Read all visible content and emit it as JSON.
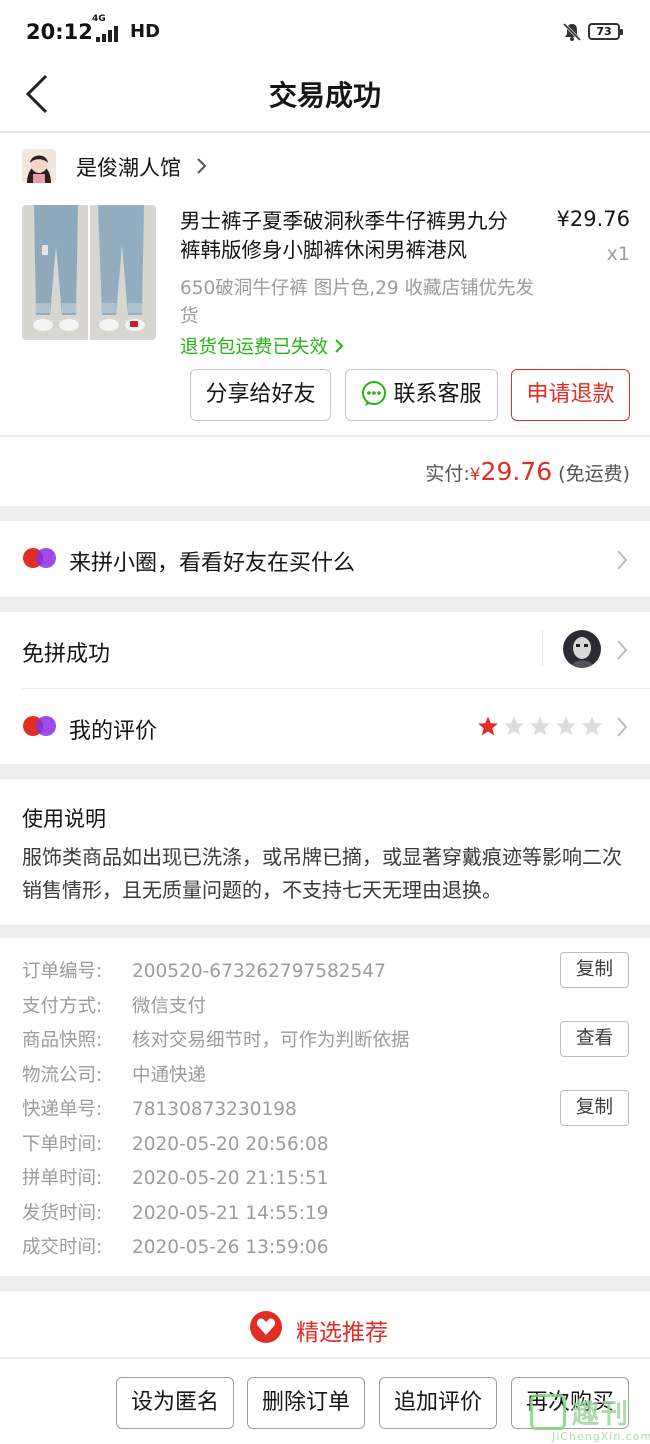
{
  "status_bar": {
    "time": "20:12",
    "network": "4G",
    "hd": "HD",
    "battery": "73"
  },
  "nav": {
    "title": "交易成功"
  },
  "shop": {
    "name": "是俊潮人馆"
  },
  "product": {
    "title": "男士裤子夏季破洞秋季牛仔裤男九分裤韩版修身小脚裤休闲男裤港风",
    "price": "¥29.76",
    "quantity": "x1",
    "spec": "650破洞牛仔裤 图片色,29 收藏店铺优先发货",
    "refund_tip": "退货包运费已失效"
  },
  "actions": {
    "share": "分享给好友",
    "contact": "联系客服",
    "refund": "申请退款"
  },
  "payment": {
    "label": "实付:",
    "currency": "¥",
    "amount": "29.76",
    "note": "(免运费)"
  },
  "circle": {
    "label": "来拼小圈，看看好友在买什么"
  },
  "group": {
    "label": "免拼成功"
  },
  "review": {
    "label": "我的评价",
    "rating": 1,
    "max_rating": 5
  },
  "usage": {
    "heading": "使用说明",
    "text": "服饰类商品如出现已洗涤，或吊牌已摘，或显著穿戴痕迹等影响二次销售情形，且无质量问题的，不支持七天无理由退换。"
  },
  "order_info": [
    {
      "key": "订单编号:",
      "value": "200520-673262797582547",
      "button": "复制"
    },
    {
      "key": "支付方式:",
      "value": "微信支付",
      "button": ""
    },
    {
      "key": "商品快照:",
      "value": "核对交易细节时，可作为判断依据",
      "button": "查看"
    },
    {
      "key": "物流公司:",
      "value": "中通快递",
      "button": ""
    },
    {
      "key": "快递单号:",
      "value": "78130873230198",
      "button": "复制"
    },
    {
      "key": "下单时间:",
      "value": "2020-05-20 20:56:08",
      "button": ""
    },
    {
      "key": "拼单时间:",
      "value": "2020-05-20 21:15:51",
      "button": ""
    },
    {
      "key": "发货时间:",
      "value": "2020-05-21 14:55:19",
      "button": ""
    },
    {
      "key": "成交时间:",
      "value": "2020-05-26 13:59:06",
      "button": ""
    }
  ],
  "recommend": {
    "label": "精选推荐"
  },
  "bottom_buttons": {
    "anonymous": "设为匿名",
    "delete": "删除订单",
    "add_review": "追加评价",
    "rebuy": "再次购买"
  },
  "watermark": {
    "text": "趣刊",
    "sub": "JiChengXin.com"
  },
  "colors": {
    "accent_red": "#e02e24",
    "green": "#25b513",
    "muted": "#9c9c9c"
  }
}
